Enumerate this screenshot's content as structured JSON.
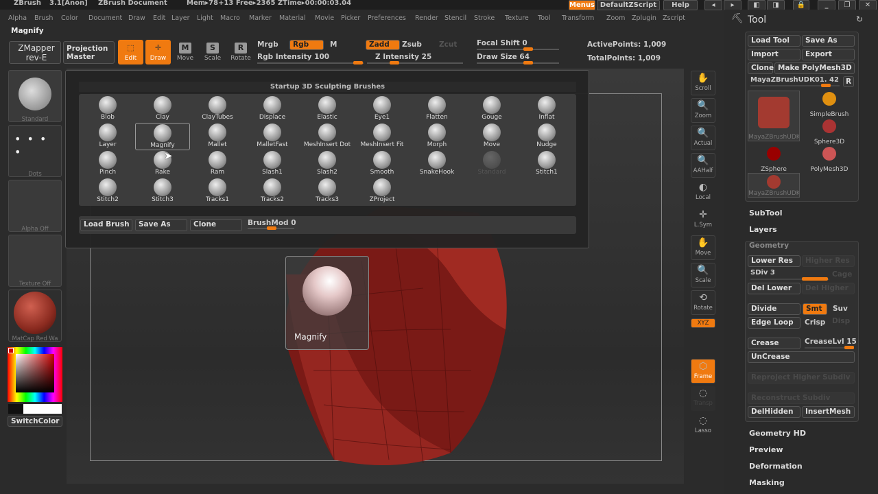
{
  "titlebar": {
    "app": "ZBrush",
    "version": "3.1[Anon]",
    "document": "ZBrush Document",
    "stats": "Mem▸78+13 Free▸2365 ZTime▸00:00:03.04",
    "menus": "Menus",
    "script": "DefaultZScript",
    "help": "Help"
  },
  "menu": [
    "Alpha",
    "Brush",
    "Color",
    "Document",
    "Draw",
    "Edit",
    "Layer",
    "Light",
    "Macro",
    "Marker",
    "Material",
    "Movie",
    "Picker",
    "Preferences",
    "Render",
    "Stencil",
    "Stroke",
    "Texture",
    "Tool",
    "Transform",
    "Zoom",
    "Zplugin",
    "Zscript"
  ],
  "current_brush": "Magnify",
  "shelf": {
    "zmapper": "ZMapper",
    "zmapper2": "rev-E",
    "projection": "Projection",
    "projection2": "Master",
    "edit": "Edit",
    "draw": "Draw",
    "move": "Move",
    "scale": "Scale",
    "rotate": "Rotate",
    "mrgb": "Mrgb",
    "rgb": "Rgb",
    "m": "M",
    "rgb_intensity": "Rgb Intensity 100",
    "zadd": "Zadd",
    "zsub": "Zsub",
    "zcut": "Zcut",
    "z_intensity": "Z Intensity 25",
    "focal_shift": "Focal Shift 0",
    "draw_size": "Draw Size 64",
    "active_points": "ActivePoints: 1,009",
    "total_points": "TotalPoints: 1,009"
  },
  "left": {
    "brush": "Standard",
    "stroke": "Dots",
    "alpha": "Alpha Off",
    "texture": "Texture Off",
    "material": "MatCap Red Wa",
    "switch_color": "SwitchColor",
    "accent": "#f07a10"
  },
  "right_shelf": [
    "Scroll",
    "Zoom",
    "Actual",
    "AAHalf",
    "Local",
    "L.Sym",
    "Move",
    "Scale",
    "Rotate",
    "XYZ",
    "Frame",
    "Transp",
    "Lasso"
  ],
  "popup": {
    "title": "Startup 3D Sculpting Brushes",
    "brushes": [
      "Blob",
      "Clay",
      "ClayTubes",
      "Displace",
      "Elastic",
      "Eye1",
      "Flatten",
      "Gouge",
      "Inflat",
      "Layer",
      "Magnify",
      "Mallet",
      "MalletFast",
      "MeshInsert Dot",
      "MeshInsert Fit",
      "Morph",
      "Move",
      "Nudge",
      "Pinch",
      "Rake",
      "Ram",
      "Slash1",
      "Slash2",
      "Smooth",
      "SnakeHook",
      "Standard",
      "Stitch1",
      "Stitch2",
      "Stitch3",
      "Tracks1",
      "Tracks2",
      "Tracks3",
      "ZProject"
    ],
    "load": "Load Brush",
    "save": "Save As",
    "clone": "Clone",
    "brushmod": "BrushMod 0"
  },
  "tooltip": "Magnify",
  "tool": {
    "title": "Tool",
    "load": "Load Tool",
    "save": "Save As",
    "import": "Import",
    "export": "Export",
    "clone": "Clone",
    "make": "Make PolyMesh3D",
    "current": "MayaZBrushUDK01. 42",
    "r": "R",
    "thumbs": [
      "MayaZBrushUDK0",
      "SimpleBrush",
      "Sphere3D",
      "ZSphere",
      "PolyMesh3D",
      "MayaZBrushUDK0"
    ],
    "subtool": "SubTool",
    "layers": "Layers",
    "geometry": "Geometry",
    "lower_res": "Lower Res",
    "higher_res": "Higher Res",
    "sdiv": "SDiv 3",
    "cage": "Cage",
    "del_lower": "Del Lower",
    "del_higher": "Del Higher",
    "divide": "Divide",
    "smt": "Smt",
    "suv": "Suv",
    "edge_loop": "Edge Loop",
    "crisp": "Crisp",
    "disp": "Disp",
    "crease": "Crease",
    "crease_lvl": "CreaseLvl 15",
    "uncrease": "UnCrease",
    "reproject": "Reproject Higher Subdiv",
    "reconstruct": "Reconstruct Subdiv",
    "delhidden": "DelHidden",
    "insertmesh": "InsertMesh",
    "geometry_hd": "Geometry HD",
    "preview": "Preview",
    "deformation": "Deformation",
    "masking": "Masking"
  }
}
